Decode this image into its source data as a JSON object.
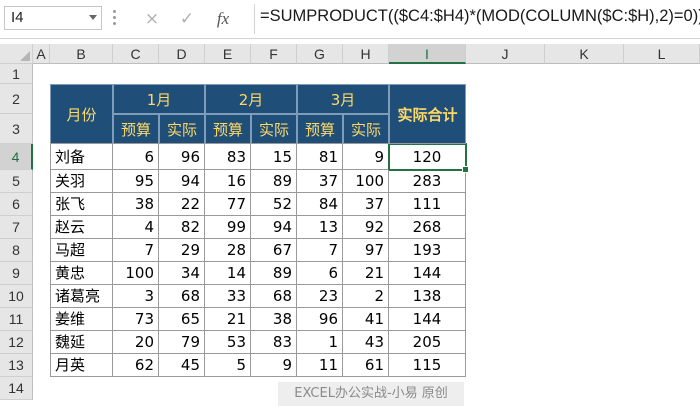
{
  "formula_bar": {
    "name_box": "I4",
    "cancel_icon": "×",
    "enter_icon": "✓",
    "fx_label": "fx",
    "formula": "=SUMPRODUCT(($C4:$H4)*(MOD(COLUMN($C:$H),2)=0))"
  },
  "columns": [
    "A",
    "B",
    "C",
    "D",
    "E",
    "F",
    "G",
    "H",
    "I",
    "J",
    "K",
    "L"
  ],
  "rows": [
    "1",
    "2",
    "3",
    "4",
    "5",
    "6",
    "7",
    "8",
    "9",
    "10",
    "11",
    "12",
    "13",
    "14"
  ],
  "selected_cell": {
    "column": "I",
    "row": "4"
  },
  "table": {
    "header_month_label": "月份",
    "months": [
      "1月",
      "2月",
      "3月"
    ],
    "sub_headers": [
      "预算",
      "实际",
      "预算",
      "实际",
      "预算",
      "实际"
    ],
    "total_label": "实际合计",
    "data": [
      {
        "name": "刘备",
        "values": [
          "6",
          "96",
          "83",
          "15",
          "81",
          "9"
        ],
        "total": "120"
      },
      {
        "name": "关羽",
        "values": [
          "95",
          "94",
          "16",
          "89",
          "37",
          "100"
        ],
        "total": "283"
      },
      {
        "name": "张飞",
        "values": [
          "38",
          "22",
          "77",
          "52",
          "84",
          "37"
        ],
        "total": "111"
      },
      {
        "name": "赵云",
        "values": [
          "4",
          "82",
          "99",
          "94",
          "13",
          "92"
        ],
        "total": "268"
      },
      {
        "name": "马超",
        "values": [
          "7",
          "29",
          "28",
          "67",
          "7",
          "97"
        ],
        "total": "193"
      },
      {
        "name": "黄忠",
        "values": [
          "100",
          "34",
          "14",
          "89",
          "6",
          "21"
        ],
        "total": "144"
      },
      {
        "name": "诸葛亮",
        "values": [
          "3",
          "68",
          "33",
          "68",
          "23",
          "2"
        ],
        "total": "138"
      },
      {
        "name": "姜维",
        "values": [
          "73",
          "65",
          "21",
          "38",
          "96",
          "41"
        ],
        "total": "144"
      },
      {
        "name": "魏延",
        "values": [
          "20",
          "79",
          "53",
          "83",
          "1",
          "43"
        ],
        "total": "205"
      },
      {
        "name": "月英",
        "values": [
          "62",
          "45",
          "5",
          "9",
          "11",
          "61"
        ],
        "total": "115"
      }
    ]
  },
  "watermark": "EXCEL办公实战-小易  原创",
  "colors": {
    "header_bg": "#1f4e79",
    "header_text": "#ffd966",
    "selection": "#217346"
  }
}
